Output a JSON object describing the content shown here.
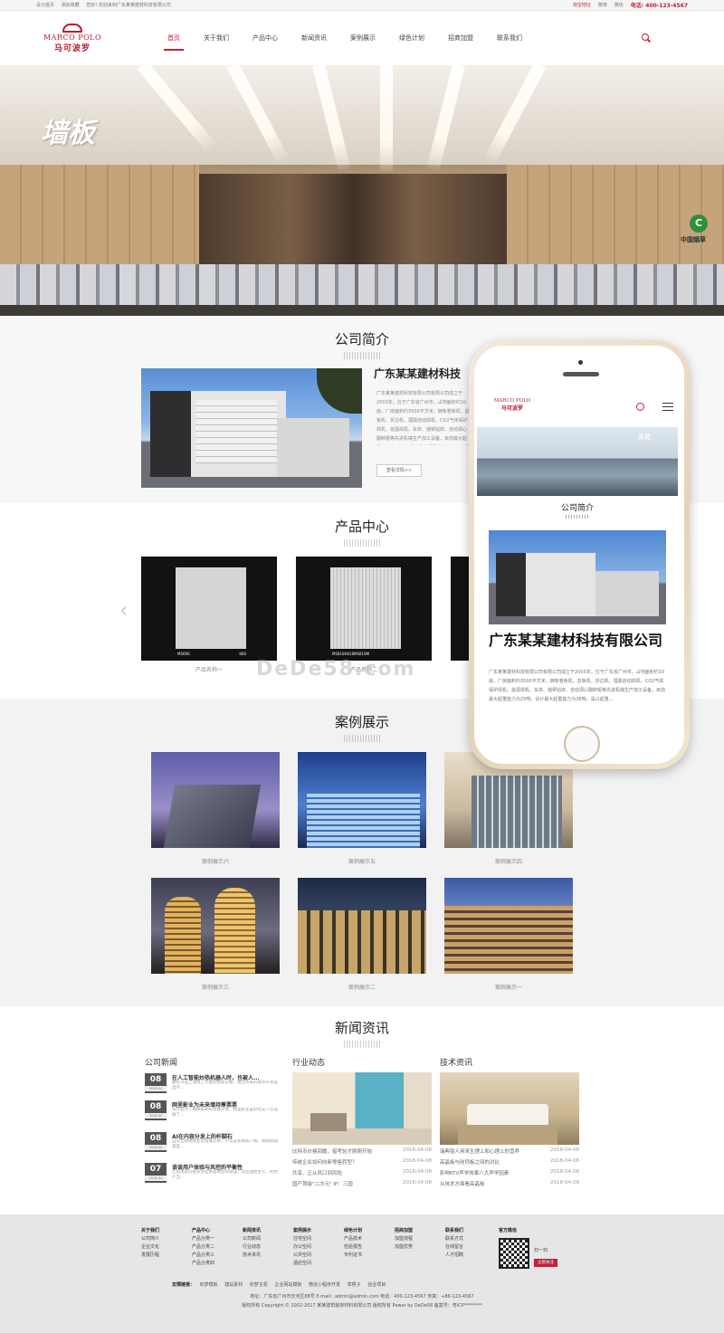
{
  "topbar": {
    "left": [
      "设为首页",
      "添加收藏",
      "您好! 欢迎来到广东某某建材科技有限公司"
    ],
    "mall": "淘宝地址",
    "weibo": "微博",
    "wechat": "微信",
    "hotline_label": "电话:",
    "hotline": "400-123-4567"
  },
  "logo": {
    "en": "MARCO POLO",
    "cn": "马可波罗"
  },
  "nav": [
    "首页",
    "关于我们",
    "产品中心",
    "新闻资讯",
    "案例展示",
    "绿色计划",
    "招商加盟",
    "联系我们"
  ],
  "nav_active_index": 0,
  "banner": {
    "title": "墙板"
  },
  "about": {
    "title": "公司简介",
    "heading": "广东某某建材科技",
    "desc": "广东某某建材科技有限公司有限公司成立于2003年，位于广东省广州市，占地面积约10亩，厂房面积约3500平方米，拥有卷板机、剪板机、折边机、埋弧自动焊机、CO2气体保护焊机、氩弧焊机、车床、摇臂钻床、自动调心翻转辊等先进机械生产加工设备，目前最大起重能力为25吨，设计最大起重能力为36吨，是以起重、环保设备、水处理设备制造安装于一体的新兴企业。公司注册资本为300万元，现有职工180人，各类专业技术及管理人员19人。",
    "more": "查看详情>>"
  },
  "products": {
    "title": "产品中心",
    "items": [
      {
        "name": "产品名称一",
        "code": "MS696",
        "code2": "666"
      },
      {
        "name": "产品名称二",
        "code": "MS818A818MS818M",
        "code2": ""
      }
    ]
  },
  "watermark": "DeDe58.com",
  "cases": {
    "title": "案例展示",
    "items": [
      "案例展示六",
      "案例展示五",
      "案例展示四",
      "案例展示三",
      "案例展示二",
      "案例展示一"
    ]
  },
  "news": {
    "title": "新闻资讯",
    "company": {
      "title": "公司新闻",
      "items": [
        {
          "day": "08",
          "ym": "2018-04",
          "title": "在人工智能炒热机器人时，也被人...",
          "summary": "最近市面上涌现了大量的智能音箱，随之而来的批评声也层出不..."
        },
        {
          "day": "08",
          "ym": "2018-04",
          "title": "网里影业为未来增持筹票票",
          "summary": "或许是为了确保影响的票额环境，网里影业虽然也又一次选择了..."
        },
        {
          "day": "08",
          "ym": "2018-04",
          "title": "AI在内容分发上的杆脚石",
          "summary": "自从互联网商业化发展以来，不论是新闻客户端、视频网站或是..."
        },
        {
          "day": "07",
          "ym": "2018-04",
          "title": "谈谈用户体验与风控的平衡性",
          "summary": "之前我说过很多创业者容易犯的错误，过度理想主义、把用户当..."
        }
      ]
    },
    "industry": {
      "title": "行业动态",
      "items": [
        {
          "title": "比特币价格回暖，借考验才刚刚开始",
          "date": "2018-04-08"
        },
        {
          "title": "传统企业如何向新零售转型？",
          "date": "2018-04-08"
        },
        {
          "title": "共享、正从风口到风险",
          "date": "2018-04-08"
        },
        {
          "title": "国产顶级\"二次元\" IP：三国",
          "date": "2018-04-08"
        }
      ]
    },
    "tech": {
      "title": "技术资讯",
      "items": [
        {
          "title": "瑞典铭人用来生理上和心理上的营养",
          "date": "2018-04-08"
        },
        {
          "title": "高晶板与硅钙板之间的对比",
          "date": "2018-04-08"
        },
        {
          "title": "影响KTV声学效果八大声学因素",
          "date": "2018-04-08"
        },
        {
          "title": "从技术方面看高晶板",
          "date": "2018-04-08"
        }
      ]
    }
  },
  "footer": {
    "cols": [
      {
        "h": "关于我们",
        "items": [
          "公司简介",
          "企业文化",
          "发展历程"
        ]
      },
      {
        "h": "产品中心",
        "items": [
          "产品分类一",
          "产品分类二",
          "产品分类三",
          "产品分类四"
        ]
      },
      {
        "h": "新闻资讯",
        "items": [
          "公司新闻",
          "行业动态",
          "技术资讯"
        ]
      },
      {
        "h": "案例展示",
        "items": [
          "住宅空间",
          "办公空间",
          "公共空间",
          "酒店空间"
        ]
      },
      {
        "h": "绿色计划",
        "items": [
          "产品技术",
          "检验报告",
          "专利证书"
        ]
      },
      {
        "h": "招商加盟",
        "items": [
          "加盟流程",
          "加盟优势"
        ]
      },
      {
        "h": "联系我们",
        "items": [
          "联系方式",
          "在线留言",
          "人才招聘"
        ]
      }
    ],
    "wechat_title": "官方微信",
    "qr_text": "扫一扫",
    "qr_btn": "立即关注",
    "links_label": "友情链接：",
    "links": [
      "织梦模板",
      "建站素材",
      "织梦主机",
      "企业网站模板",
      "微信小程序开发",
      "草根子",
      "创业项目"
    ],
    "address": "地址：广东省广州市天河区88号  E-mail：admin@admin.com  电话：400-123-4567  传真：+86-123-4567",
    "copyright": "版权所有 Copyright © 2002-2017 某某建筑装饰材料有限公司 版权所有 Power by DeDe58 备案号：粤ICP********"
  },
  "mobile": {
    "logo_en": "MARCO POLO",
    "logo_cn": "马可波罗",
    "banner_text": "天花",
    "section_title": "公司简介",
    "heading": "广东某某建材科技有限公司",
    "desc": "广东某某建材科技有限公司有限公司成立于2003年，位于广东省广州市，占地面积约10亩，厂房面积约3500平方米，拥有卷板机、剪板机、折边机、埋弧自动焊机、CO2气体保护焊机、氩弧焊机、车床、摇臂钻床、自动调心翻转辊等先进机械生产加工设备，目前最大起重能力为25吨，设计最大起重能力为36吨，是以起重..."
  }
}
